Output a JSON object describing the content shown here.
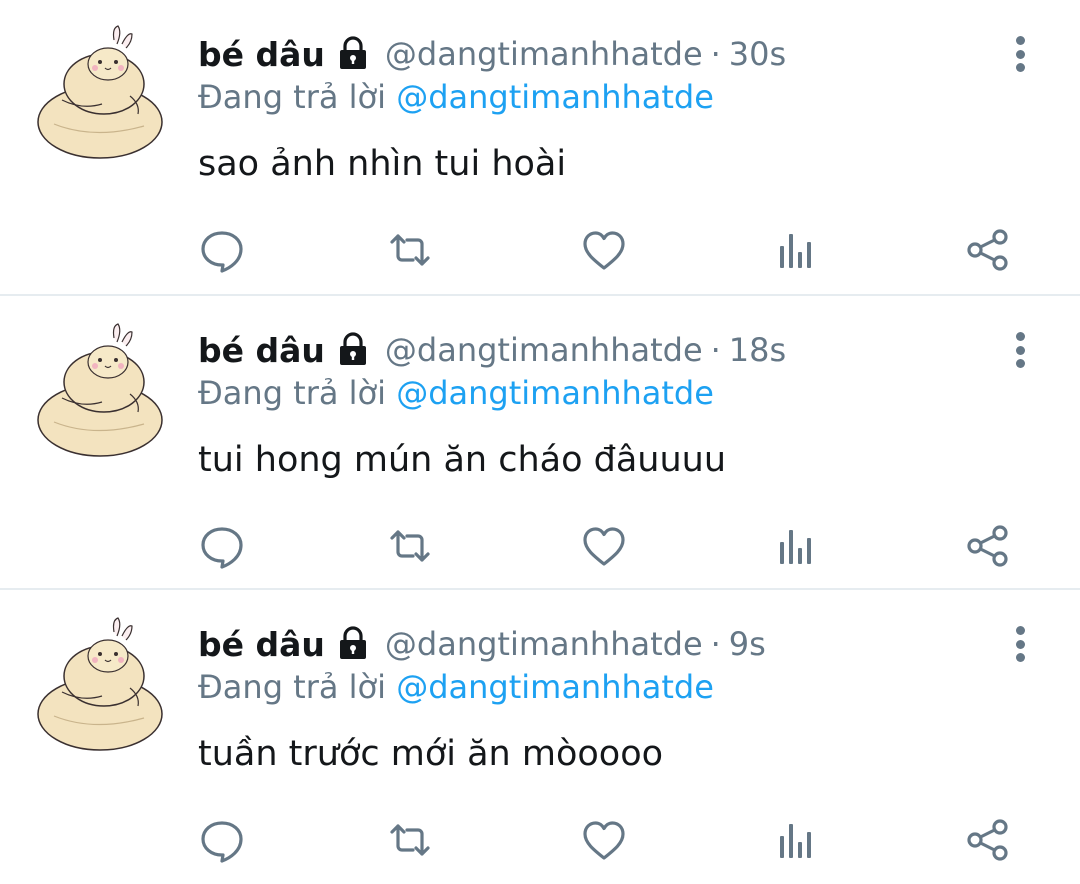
{
  "colors": {
    "text_primary": "#14171a",
    "text_secondary": "#657786",
    "mention": "#1da1f2",
    "divider": "#e6ecf0",
    "icon": "#657786"
  },
  "tweets": [
    {
      "author_name": "bé dâu",
      "author_handle": "@dangtimanhhatde",
      "separator": "·",
      "timestamp": "30s",
      "reply_prefix": "Đang trả lời",
      "reply_to": "@dangtimanhhatde",
      "text": "sao ảnh nhìn tui hoài"
    },
    {
      "author_name": "bé dâu",
      "author_handle": "@dangtimanhhatde",
      "separator": "·",
      "timestamp": "18s",
      "reply_prefix": "Đang trả lời",
      "reply_to": "@dangtimanhhatde",
      "text": "tui hong mún ăn cháo đâuuuu"
    },
    {
      "author_name": "bé dâu",
      "author_handle": "@dangtimanhhatde",
      "separator": "·",
      "timestamp": "9s",
      "reply_prefix": "Đang trả lời",
      "reply_to": "@dangtimanhhatde",
      "text": "tuần trước mới ăn mòoooo"
    }
  ],
  "icons": {
    "avatar": "blob-bunny-avatar",
    "lock": "lock-icon",
    "more": "more-vertical-icon",
    "reply": "reply-icon",
    "retweet": "retweet-icon",
    "like": "heart-icon",
    "stats": "analytics-icon",
    "share": "share-icon"
  }
}
